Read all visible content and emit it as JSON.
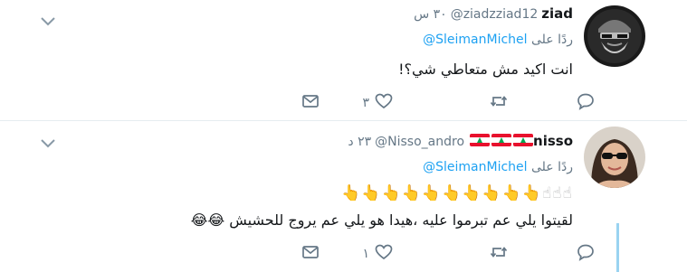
{
  "tweets": [
    {
      "fullname": "ziad",
      "screen_name": "@ziadzziad12",
      "time": "٣٠ س",
      "reply_prefix": "ردًا على",
      "reply_to": "@SleimanMichel",
      "text": "انت اكيد مش متعاطي شي؟!",
      "like_count": "٣",
      "retweet_count": "",
      "reply_count": ""
    },
    {
      "fullname": "nisso",
      "screen_name": "@Nisso_andro",
      "time": "٢٣ د",
      "reply_prefix": "ردًا على",
      "reply_to": "@SleimanMichel",
      "emoji_faded": "☝☝☝",
      "emoji_line": "👆👆👆👆👆👆👆👆👆👆",
      "text": "لقيتوا يلي عم تبرموا عليه ،هيدا هو يلي عم يروج للحشيش",
      "text_emoji": "😂😂",
      "like_count": "١",
      "retweet_count": "",
      "reply_count": ""
    }
  ],
  "icons": {
    "caret": "chevron-down-icon",
    "dm": "envelope-icon",
    "like": "heart-icon",
    "retweet": "retweet-icon",
    "reply": "reply-bubble-icon"
  },
  "colors": {
    "link": "#1da1f2",
    "muted": "#657786",
    "thread_line": "#9ad3f1",
    "flag_red": "#e8112d",
    "flag_green": "#00a651"
  }
}
